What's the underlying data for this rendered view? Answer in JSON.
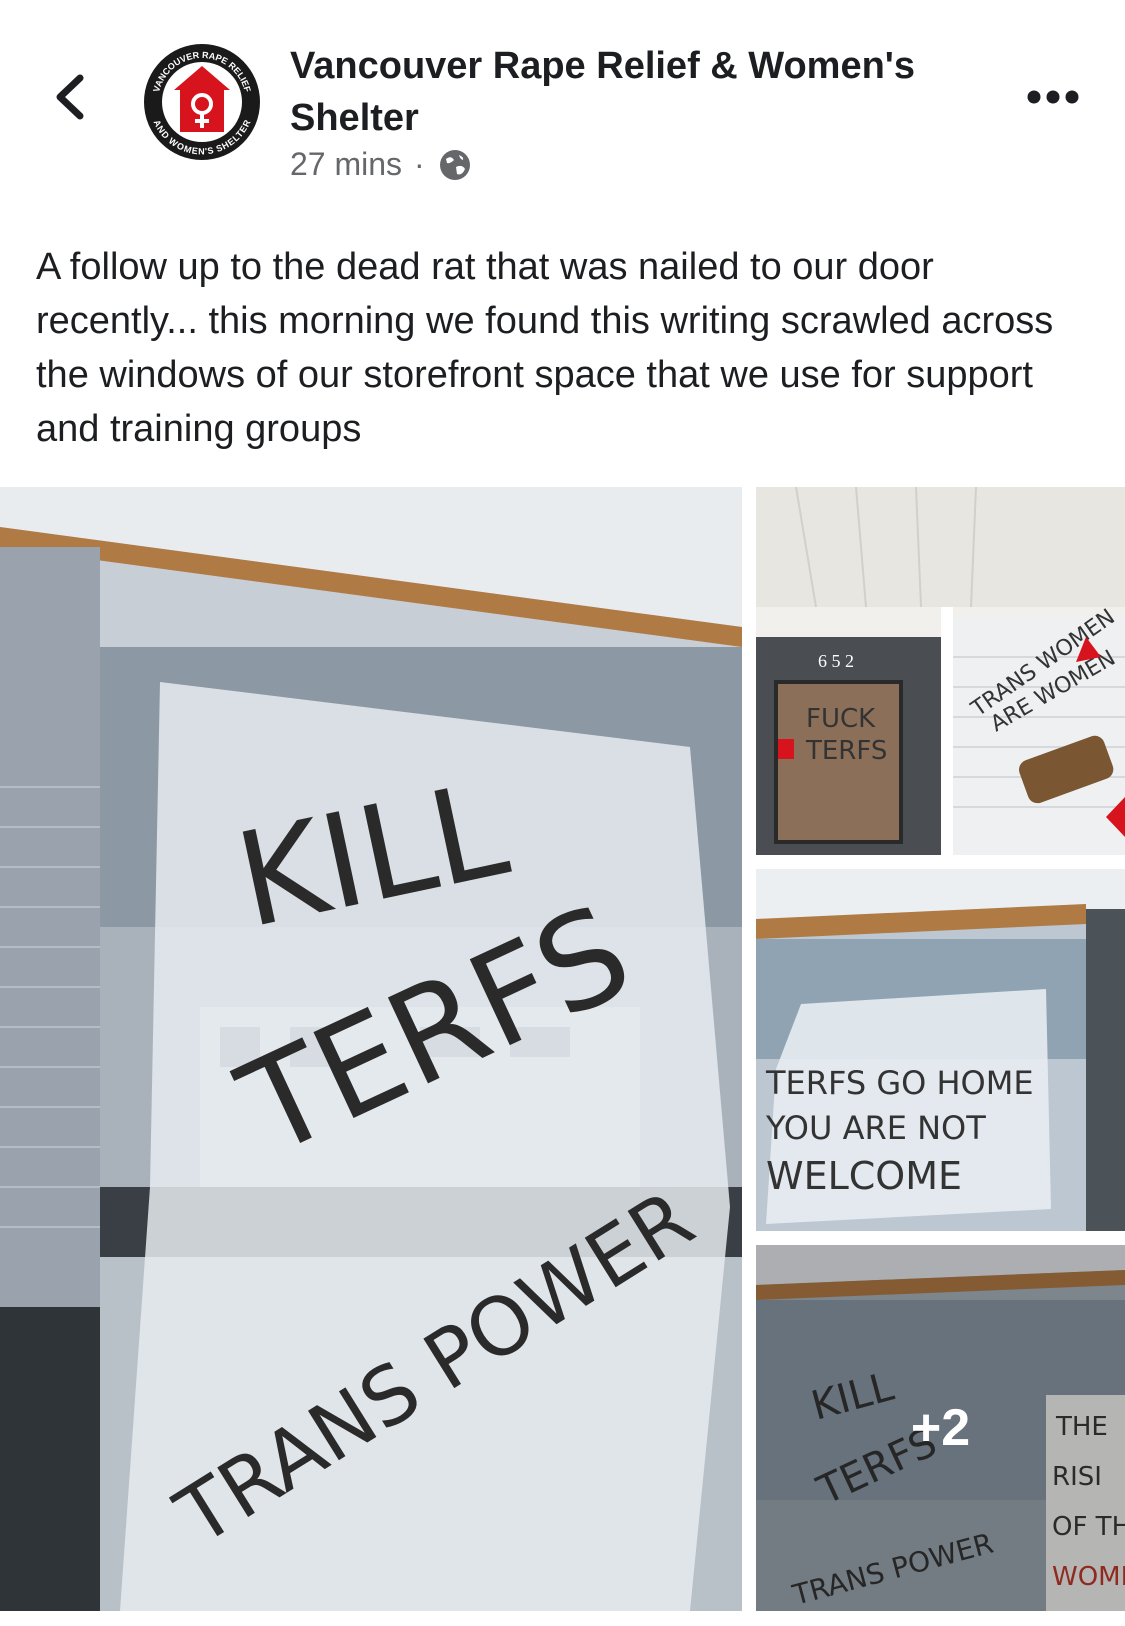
{
  "header": {
    "page_name": "Vancouver Rape Relief & Women's Shelter",
    "timestamp": "27 mins",
    "separator": "·",
    "privacy_icon": "globe-icon",
    "back_icon": "chevron-left-icon",
    "more_icon": "ellipsis-icon",
    "avatar": {
      "top_text": "VANCOUVER RAPE RELIEF",
      "bottom_text": "AND WOMEN'S SHELTER",
      "accent": "#d7141e"
    }
  },
  "post": {
    "text": "A follow up to the dead rat that was nailed to our door recently... this morning we found this writing scrawled across the windows of our storefront space that we use for support and training groups"
  },
  "photos": {
    "main": {
      "line1": "KILL",
      "line2": "TERFS",
      "line3": "TRANS POWER"
    },
    "second": {
      "number": "6 5 2",
      "door_line1": "FUCK",
      "door_line2": "TERFS",
      "window_line1": "TRANS WOMEN",
      "window_line2": "ARE WOMEN"
    },
    "third": {
      "line1": "TERFS GO HOME",
      "line2": "YOU ARE NOT",
      "line3": "WELCOME"
    },
    "fourth": {
      "more_count": "+2",
      "line1": "KILL",
      "line2": "TERFS",
      "line3": "TRANS POWER",
      "side_line1": "THE",
      "side_line2": "RISI",
      "side_line3": "OF TH",
      "side_line4": "WOME"
    }
  },
  "colors": {
    "text": "#1c1e21",
    "secondary": "#65676b",
    "brand_red": "#d7141e"
  }
}
